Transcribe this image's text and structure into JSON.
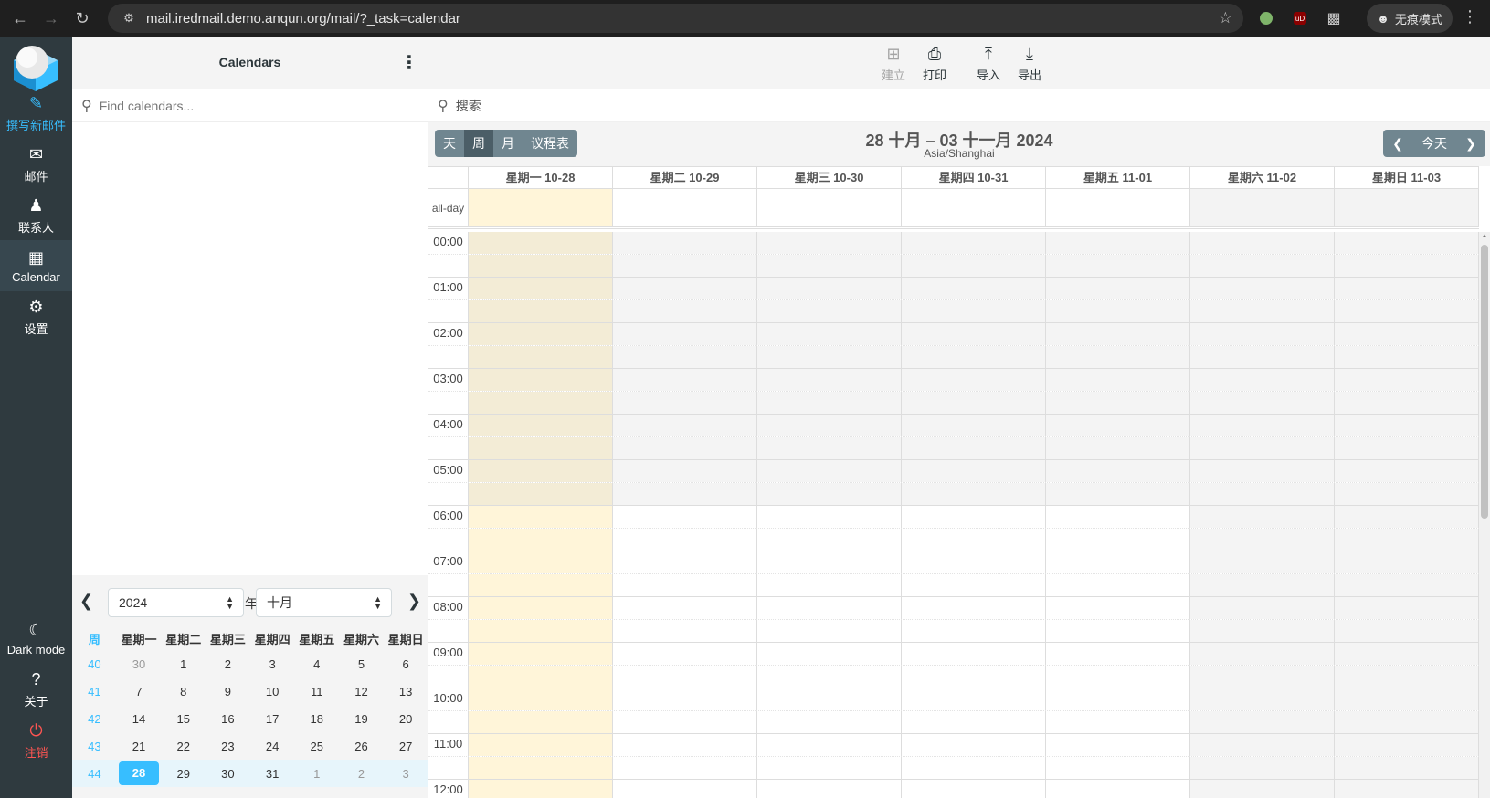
{
  "browser": {
    "url": "mail.iredmail.demo.anqun.org/mail/?_task=calendar",
    "incognito_label": "无痕模式"
  },
  "taskmenu": {
    "compose": "撰写新邮件",
    "mail": "邮件",
    "contacts": "联系人",
    "calendar": "Calendar",
    "settings": "设置",
    "dark_mode": "Dark mode",
    "about": "关于",
    "logout": "注销"
  },
  "sidebar": {
    "title": "Calendars",
    "search_placeholder": "Find calendars..."
  },
  "datepicker": {
    "year": "2024",
    "year_suffix": "年",
    "month": "十月",
    "week_header": "周",
    "weekdays": [
      "星期一",
      "星期二",
      "星期三",
      "星期四",
      "星期五",
      "星期六",
      "星期日"
    ],
    "weeks": [
      {
        "week": "40",
        "days": [
          "30",
          "1",
          "2",
          "3",
          "4",
          "5",
          "6"
        ]
      },
      {
        "week": "41",
        "days": [
          "7",
          "8",
          "9",
          "10",
          "11",
          "12",
          "13"
        ]
      },
      {
        "week": "42",
        "days": [
          "14",
          "15",
          "16",
          "17",
          "18",
          "19",
          "20"
        ]
      },
      {
        "week": "43",
        "days": [
          "21",
          "22",
          "23",
          "24",
          "25",
          "26",
          "27"
        ]
      },
      {
        "week": "44",
        "days": [
          "28",
          "29",
          "30",
          "31",
          "1",
          "2",
          "3"
        ]
      }
    ]
  },
  "toolbar": {
    "create": "建立",
    "print": "打印",
    "import": "导入",
    "export": "导出"
  },
  "search": {
    "placeholder": "搜索"
  },
  "calendar": {
    "views": [
      "天",
      "周",
      "月",
      "议程表"
    ],
    "active_view": "周",
    "title": "28 十月 – 03 十一月 2024",
    "timezone": "Asia/Shanghai",
    "today_label": "今天",
    "allday_label": "all-day",
    "days": [
      "星期一 10-28",
      "星期二 10-29",
      "星期三 10-30",
      "星期四 10-31",
      "星期五 11-01",
      "星期六 11-02",
      "星期日 11-03"
    ],
    "hours": [
      "00:00",
      "01:00",
      "02:00",
      "03:00",
      "04:00",
      "05:00",
      "06:00",
      "07:00",
      "08:00",
      "09:00",
      "10:00",
      "11:00",
      "12:00"
    ]
  }
}
